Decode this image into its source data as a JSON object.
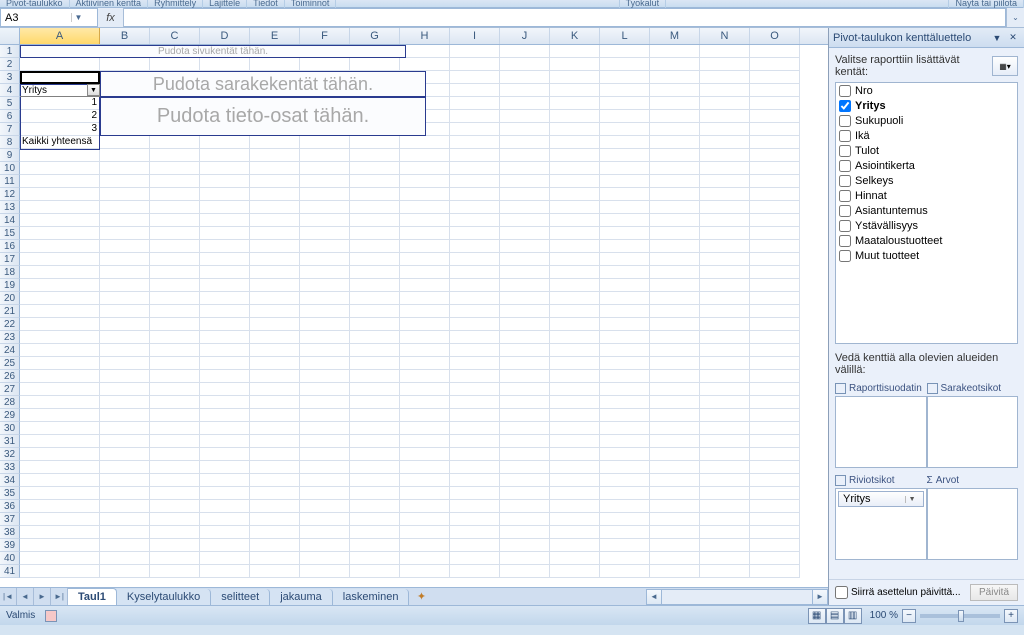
{
  "ribbon_groups": [
    "Pivot-taulukko",
    "Aktiivinen kentta",
    "Ryhmittely",
    "Lajittele",
    "Tiedot",
    "Toiminnot",
    "",
    "Tyokalut",
    "",
    "Nayta tai piilota"
  ],
  "name_box": "A3",
  "fx_label": "fx",
  "columns": [
    "A",
    "B",
    "C",
    "D",
    "E",
    "F",
    "G",
    "H",
    "I",
    "J",
    "K",
    "L",
    "M",
    "N",
    "O"
  ],
  "row_count": 41,
  "pivot": {
    "page_hint": "Pudota sivukentät tähän.",
    "col_hint": "Pudota sarakekentät tähän.",
    "data_hint": "Pudota tieto-osat tähän.",
    "row_field": "Yritys",
    "row_values": [
      "1",
      "2",
      "3"
    ],
    "row_total": "Kaikki yhteensä"
  },
  "task_pane": {
    "title": "Pivot-taulukon kenttäluettelo",
    "choose_label": "Valitse raporttiin lisättävät kentät:",
    "fields": [
      {
        "name": "Nro",
        "checked": false
      },
      {
        "name": "Yritys",
        "checked": true,
        "bold": true
      },
      {
        "name": "Sukupuoli",
        "checked": false
      },
      {
        "name": "Ikä",
        "checked": false
      },
      {
        "name": "Tulot",
        "checked": false
      },
      {
        "name": "Asiointikerta",
        "checked": false
      },
      {
        "name": "Selkeys",
        "checked": false
      },
      {
        "name": "Hinnat",
        "checked": false
      },
      {
        "name": "Asiantuntemus",
        "checked": false
      },
      {
        "name": "Ystävällisyys",
        "checked": false
      },
      {
        "name": "Maataloustuotteet",
        "checked": false
      },
      {
        "name": "Muut tuotteet",
        "checked": false
      }
    ],
    "drag_label": "Vedä kenttiä alla olevien alueiden välillä:",
    "area_filter": "Raporttisuodatin",
    "area_cols": "Sarakeotsikot",
    "area_rows": "Riviotsikot",
    "area_vals": "Arvot",
    "sigma": "Σ",
    "row_area_item": "Yritys",
    "defer_label": "Siirrä asettelun päivittä...",
    "update_btn": "Päivitä"
  },
  "tabs": {
    "items": [
      "Taul1",
      "Kyselytaulukko",
      "selitteet",
      "jakauma",
      "laskeminen"
    ],
    "active": 0
  },
  "status": {
    "ready": "Valmis",
    "zoom": "100 %"
  }
}
